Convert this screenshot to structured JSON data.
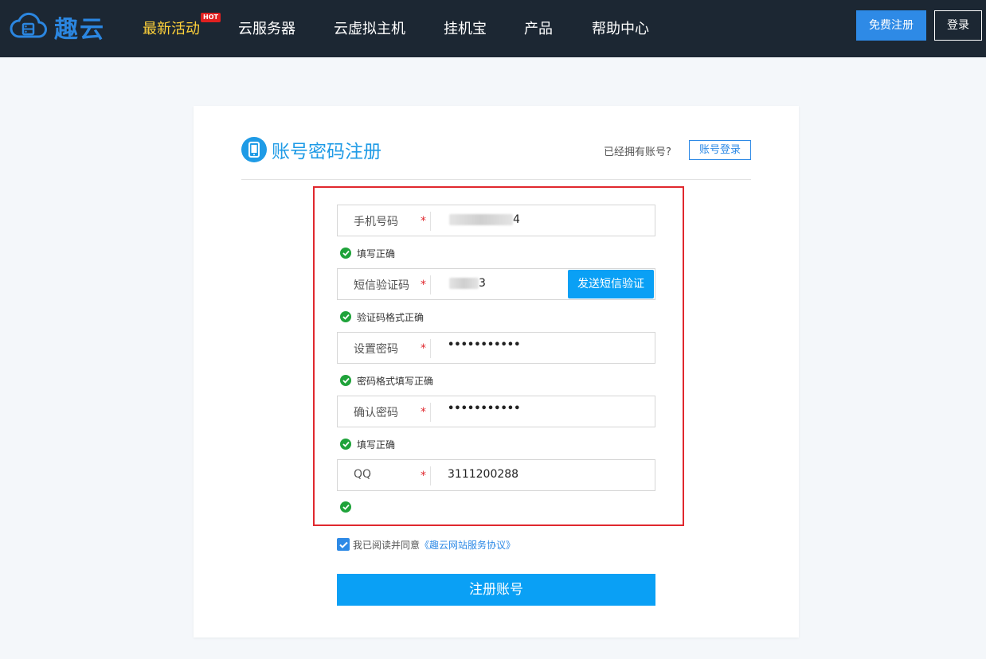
{
  "header": {
    "brand": "趣云",
    "nav": [
      {
        "label": "最新活动",
        "active": true
      },
      {
        "label": "云服务器"
      },
      {
        "label": "云虚拟主机"
      },
      {
        "label": "挂机宝"
      },
      {
        "label": "产品"
      },
      {
        "label": "帮助中心"
      }
    ],
    "hot_badge": "HOT",
    "register_button": "免费注册",
    "login_button": "登录"
  },
  "card": {
    "title": "账号密码注册",
    "have_account_text": "已经拥有账号?",
    "login_link": "账号登录"
  },
  "form": {
    "phone": {
      "label": "手机号码",
      "required": "*",
      "value_suffix": "4",
      "hint": "填写正确"
    },
    "sms_code": {
      "label": "短信验证码",
      "required": "*",
      "value_suffix": "3",
      "button": "发送短信验证",
      "hint": "验证码格式正确"
    },
    "password": {
      "label": "设置密码",
      "required": "*",
      "value": "•••••••••••",
      "hint": "密码格式填写正确"
    },
    "confirm_password": {
      "label": "确认密码",
      "required": "*",
      "value": "•••••••••••",
      "hint": "填写正确"
    },
    "qq": {
      "label": "QQ",
      "required": "*",
      "value": "3111200288",
      "hint": ""
    }
  },
  "agreement": {
    "checked": true,
    "text": "我已阅读并同意",
    "link": "《趣云网站服务协议》"
  },
  "submit_label": "注册账号",
  "colors": {
    "topbar": "#1c2733",
    "accent": "#0aa0f5",
    "brand": "#2b86e0",
    "active_nav": "#ffd23a",
    "success": "#1fa33a",
    "highlight_border": "#e0282e"
  }
}
